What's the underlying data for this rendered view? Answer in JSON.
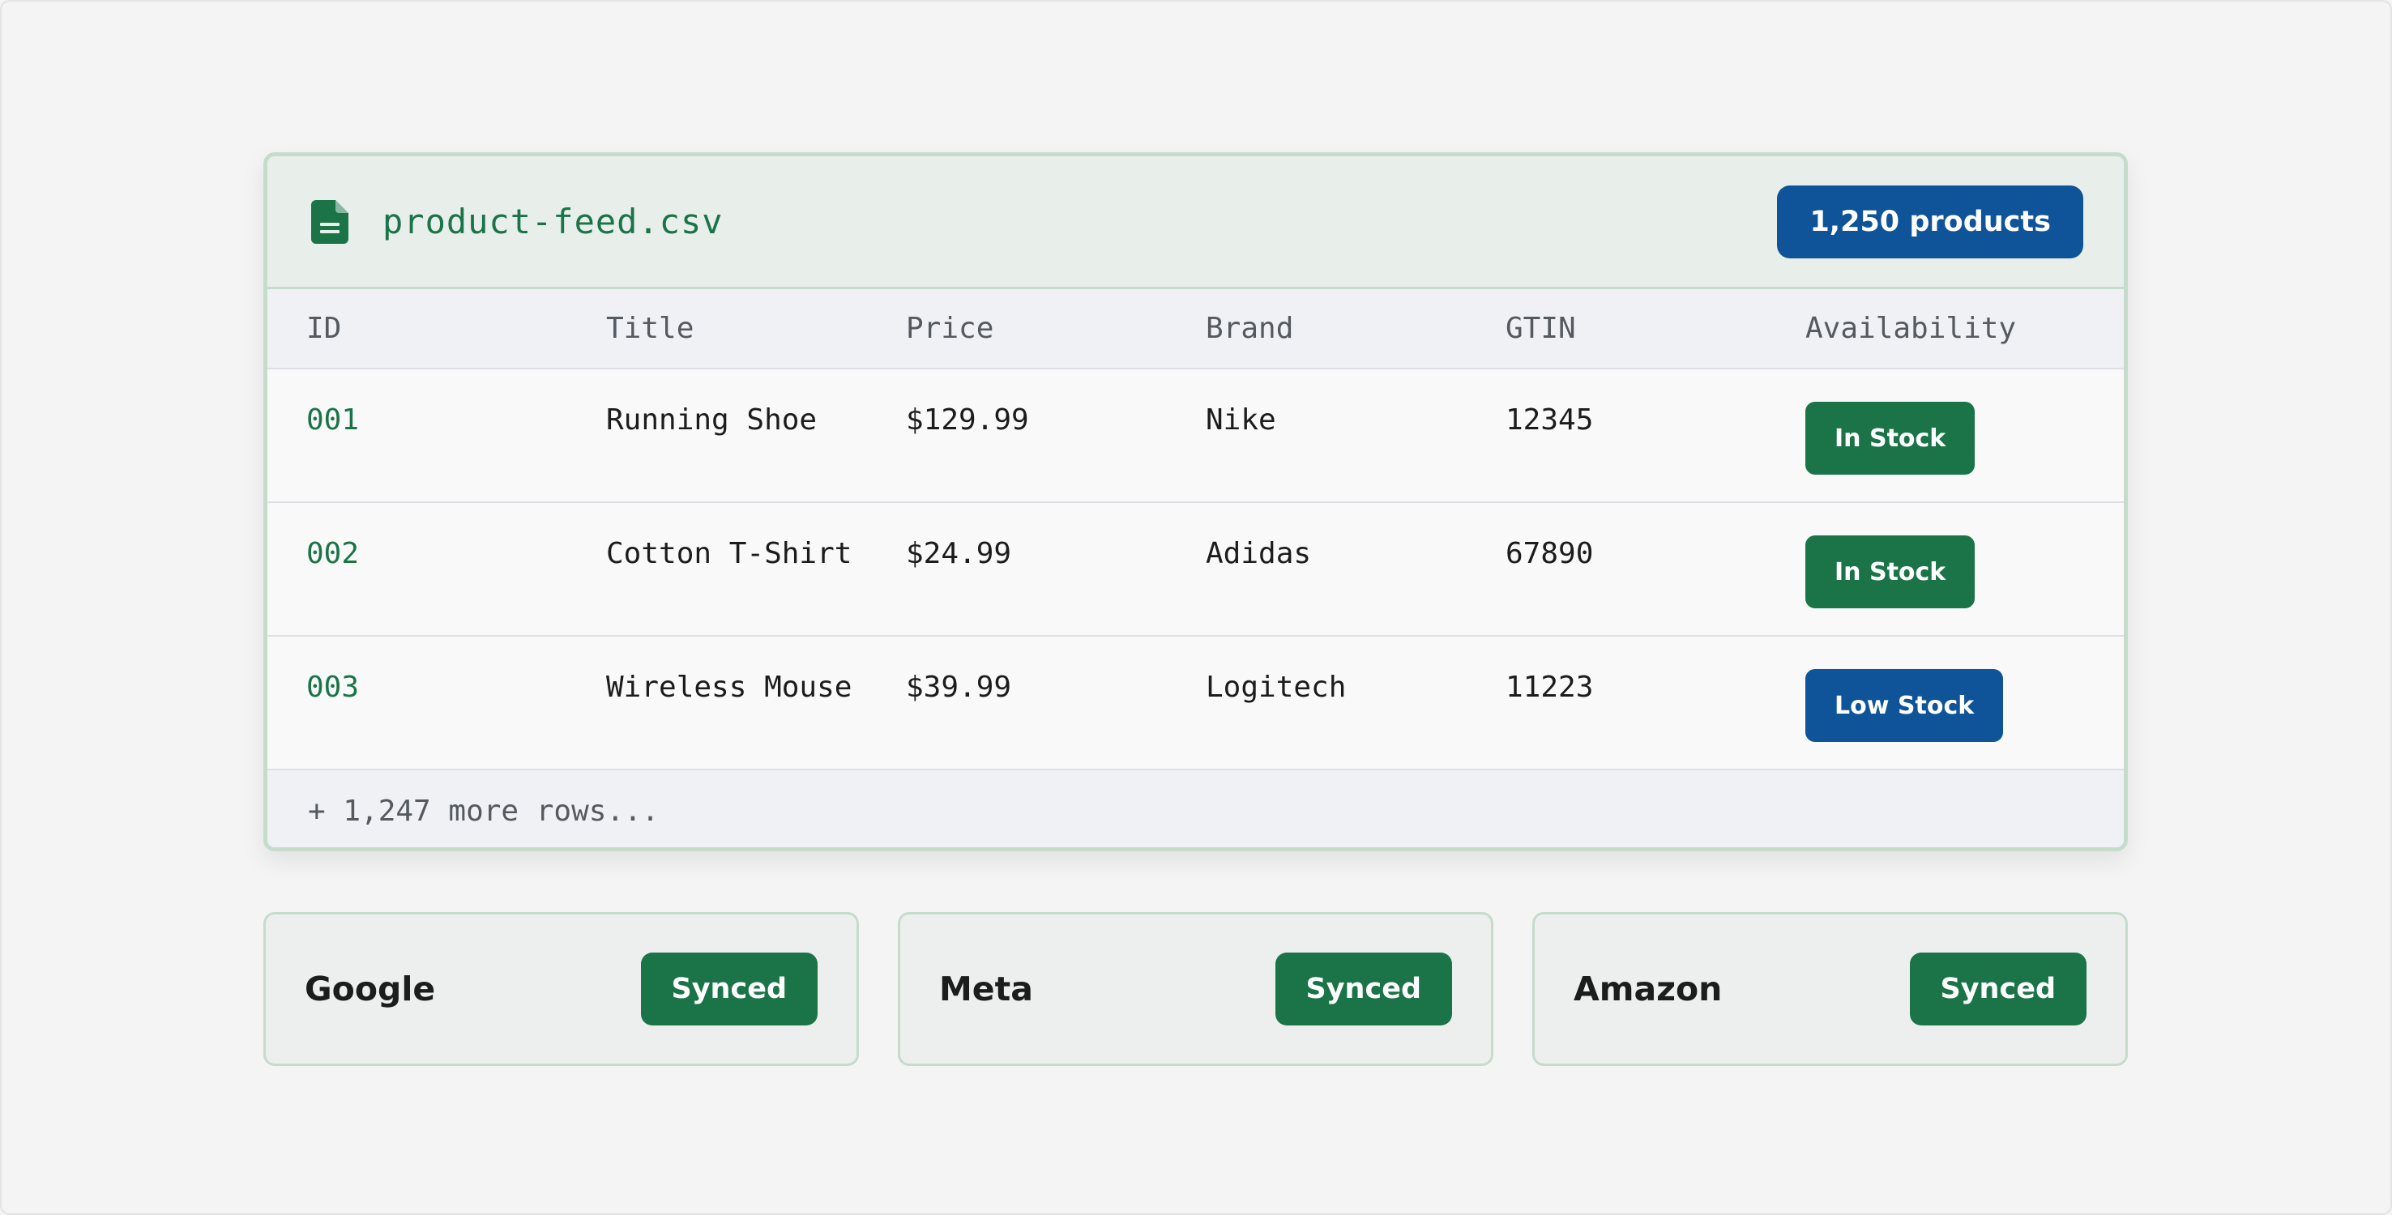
{
  "feed": {
    "filename": "product-feed.csv",
    "count_label": "1,250 products",
    "columns": [
      "ID",
      "Title",
      "Price",
      "Brand",
      "GTIN",
      "Availability"
    ],
    "rows": [
      {
        "id": "001",
        "title": "Running Shoe",
        "price": "$129.99",
        "brand": "Nike",
        "gtin": "12345",
        "availability": "In Stock",
        "status_color": "#1a7447"
      },
      {
        "id": "002",
        "title": "Cotton T-Shirt",
        "price": "$24.99",
        "brand": "Adidas",
        "gtin": "67890",
        "availability": "In Stock",
        "status_color": "#1a7447"
      },
      {
        "id": "003",
        "title": "Wireless Mouse",
        "price": "$39.99",
        "brand": "Logitech",
        "gtin": "11223",
        "availability": "Low Stock",
        "status_color": "#0f5398"
      }
    ],
    "more_rows_label": "+ 1,247 more rows..."
  },
  "channels": [
    {
      "name": "Google",
      "status": "Synced"
    },
    {
      "name": "Meta",
      "status": "Synced"
    },
    {
      "name": "Amazon",
      "status": "Synced"
    }
  ],
  "colors": {
    "accent_green": "#1a7447",
    "accent_blue": "#0f5398",
    "border": "#c5dccd"
  },
  "icons": {
    "file": "file-document-icon"
  }
}
